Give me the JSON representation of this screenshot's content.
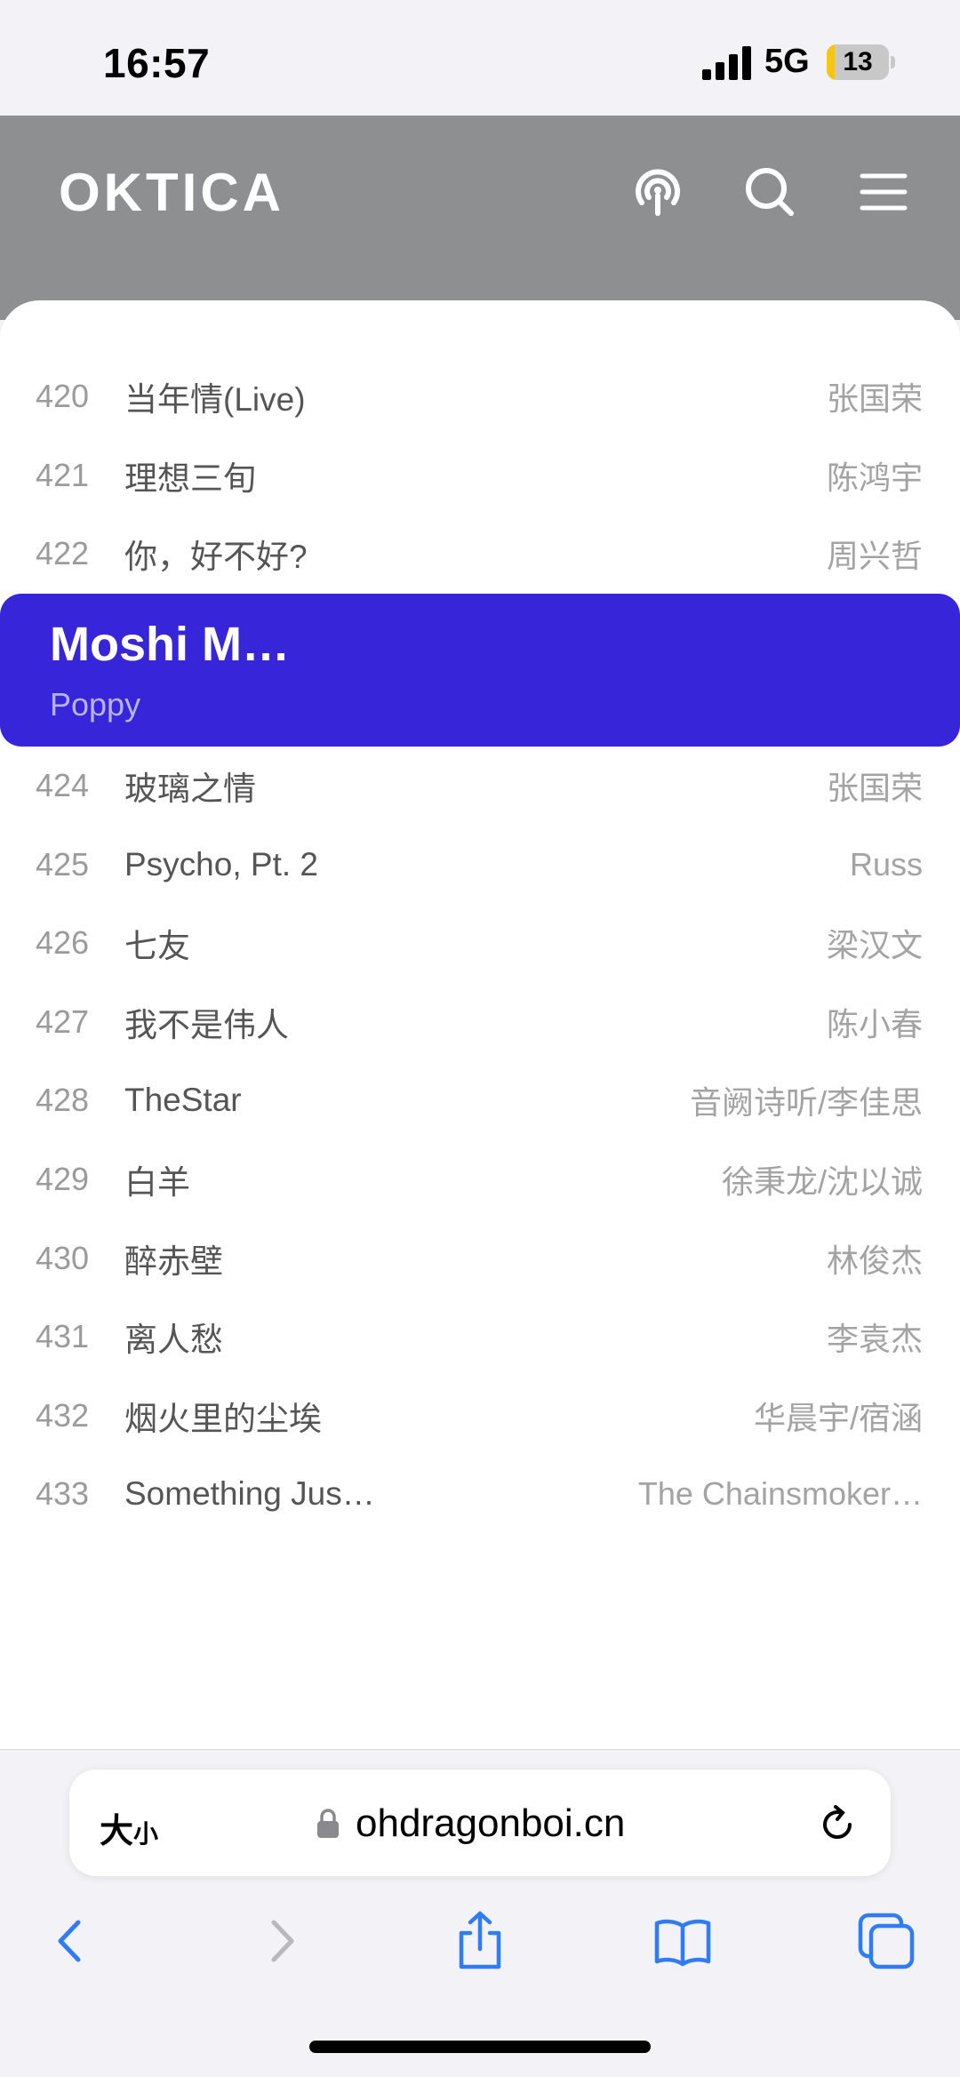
{
  "status_bar": {
    "time": "16:57",
    "network": "5G",
    "battery": "13",
    "battery_level": 0.13
  },
  "header": {
    "logo": "OKTICA",
    "icons": [
      "podcast-icon",
      "search-icon",
      "menu-icon"
    ]
  },
  "tracks_before": [
    {
      "num": "420",
      "title": "当年情(Live)",
      "artist": "张国荣"
    },
    {
      "num": "421",
      "title": "理想三旬",
      "artist": "陈鸿宇"
    },
    {
      "num": "422",
      "title": "你，好不好?",
      "artist": "周兴哲"
    }
  ],
  "active_track": {
    "title": "Moshi M…",
    "artist": "Poppy"
  },
  "tracks_after": [
    {
      "num": "424",
      "title": "玻璃之情",
      "artist": "张国荣"
    },
    {
      "num": "425",
      "title": "Psycho, Pt. 2",
      "artist": "Russ"
    },
    {
      "num": "426",
      "title": "七友",
      "artist": "梁汉文"
    },
    {
      "num": "427",
      "title": "我不是伟人",
      "artist": "陈小春"
    },
    {
      "num": "428",
      "title": "TheStar",
      "artist": "音阙诗听/李佳思"
    },
    {
      "num": "429",
      "title": "白羊",
      "artist": "徐秉龙/沈以诚"
    },
    {
      "num": "430",
      "title": "醉赤壁",
      "artist": "林俊杰"
    },
    {
      "num": "431",
      "title": "离人愁",
      "artist": "李袁杰"
    },
    {
      "num": "432",
      "title": "烟火里的尘埃",
      "artist": "华晨宇/宿涵"
    },
    {
      "num": "433",
      "title": "Something Jus…",
      "artist": "The Chainsmoker…"
    }
  ],
  "browser": {
    "text_size_label_big": "大",
    "text_size_label_small": "小",
    "url": "ohdragonboi.cn",
    "toolbar_icons": [
      "back-icon",
      "forward-icon",
      "share-icon",
      "bookmarks-icon",
      "tabs-icon"
    ]
  },
  "colors": {
    "accent": "#3726d9",
    "header_bg": "#8e8f91",
    "link_blue": "#2f7cf6"
  }
}
